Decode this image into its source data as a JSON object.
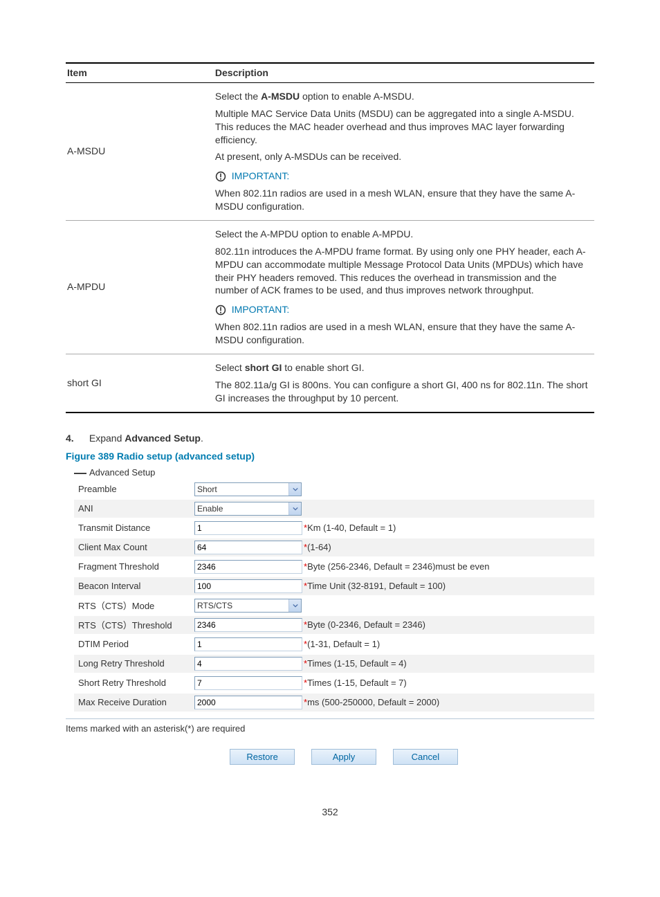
{
  "table": {
    "headers": {
      "item": "Item",
      "desc": "Description"
    },
    "rows": [
      {
        "item": "A-MSDU",
        "p1_pre": "Select the ",
        "p1_bold": "A-MSDU",
        "p1_post": " option to enable A-MSDU.",
        "p2": "Multiple MAC Service Data Units (MSDU) can be aggregated into a single A-MSDU. This reduces the MAC header overhead and thus improves MAC layer forwarding efficiency.",
        "p3": "At present, only A-MSDUs can be received.",
        "important": "IMPORTANT:",
        "p4": "When 802.11n radios are used in a mesh WLAN, ensure that they have the same A-MSDU configuration."
      },
      {
        "item": "A-MPDU",
        "p1": "Select the A-MPDU option to enable A-MPDU.",
        "p2": "802.11n introduces the A-MPDU frame format. By using only one PHY header, each A-MPDU can accommodate multiple Message Protocol Data Units (MPDUs) which have their PHY headers removed. This reduces the overhead in transmission and the number of ACK frames to be used, and thus improves network throughput.",
        "important": "IMPORTANT:",
        "p3": "When 802.11n radios are used in a mesh WLAN, ensure that they have the same A-MSDU configuration."
      },
      {
        "item": "short GI",
        "p1_pre": "Select ",
        "p1_bold": "short GI",
        "p1_post": " to enable short GI.",
        "p2": "The 802.11a/g GI is 800ns. You can configure a short GI, 400 ns for 802.11n. The short GI increases the throughput by 10 percent."
      }
    ]
  },
  "step": {
    "num": "4.",
    "pre": "Expand ",
    "bold": "Advanced Setup",
    "post": "."
  },
  "figure": {
    "caption": "Figure 389 Radio setup (advanced setup)"
  },
  "form": {
    "section": "Advanced Setup",
    "rows": [
      {
        "label": "Preamble",
        "type": "select",
        "value": "Short",
        "hint": ""
      },
      {
        "label": "ANI",
        "type": "select",
        "value": "Enable",
        "hint": ""
      },
      {
        "label": "Transmit Distance",
        "type": "text",
        "value": "1",
        "hint": "Km (1-40, Default = 1)"
      },
      {
        "label": "Client Max Count",
        "type": "text",
        "value": "64",
        "hint": "(1-64)"
      },
      {
        "label": "Fragment Threshold",
        "type": "text",
        "value": "2346",
        "hint": "Byte (256-2346, Default = 2346)must be even"
      },
      {
        "label": "Beacon Interval",
        "type": "text",
        "value": "100",
        "hint": "Time Unit (32-8191, Default = 100)"
      },
      {
        "label": "RTS（CTS）Mode",
        "type": "select",
        "value": "RTS/CTS",
        "hint": ""
      },
      {
        "label": "RTS（CTS）Threshold",
        "type": "text",
        "value": "2346",
        "hint": "Byte (0-2346, Default = 2346)"
      },
      {
        "label": "DTIM Period",
        "type": "text",
        "value": "1",
        "hint": "(1-31, Default = 1)"
      },
      {
        "label": "Long Retry Threshold",
        "type": "text",
        "value": "4",
        "hint": "Times (1-15, Default = 4)"
      },
      {
        "label": "Short Retry Threshold",
        "type": "text",
        "value": "7",
        "hint": "Times (1-15, Default = 7)"
      },
      {
        "label": "Max Receive Duration",
        "type": "text",
        "value": "2000",
        "hint": "ms (500-250000, Default = 2000)"
      }
    ],
    "footnote": "Items marked with an asterisk(*) are required",
    "buttons": {
      "restore": "Restore",
      "apply": "Apply",
      "cancel": "Cancel"
    }
  },
  "page_number": "352"
}
